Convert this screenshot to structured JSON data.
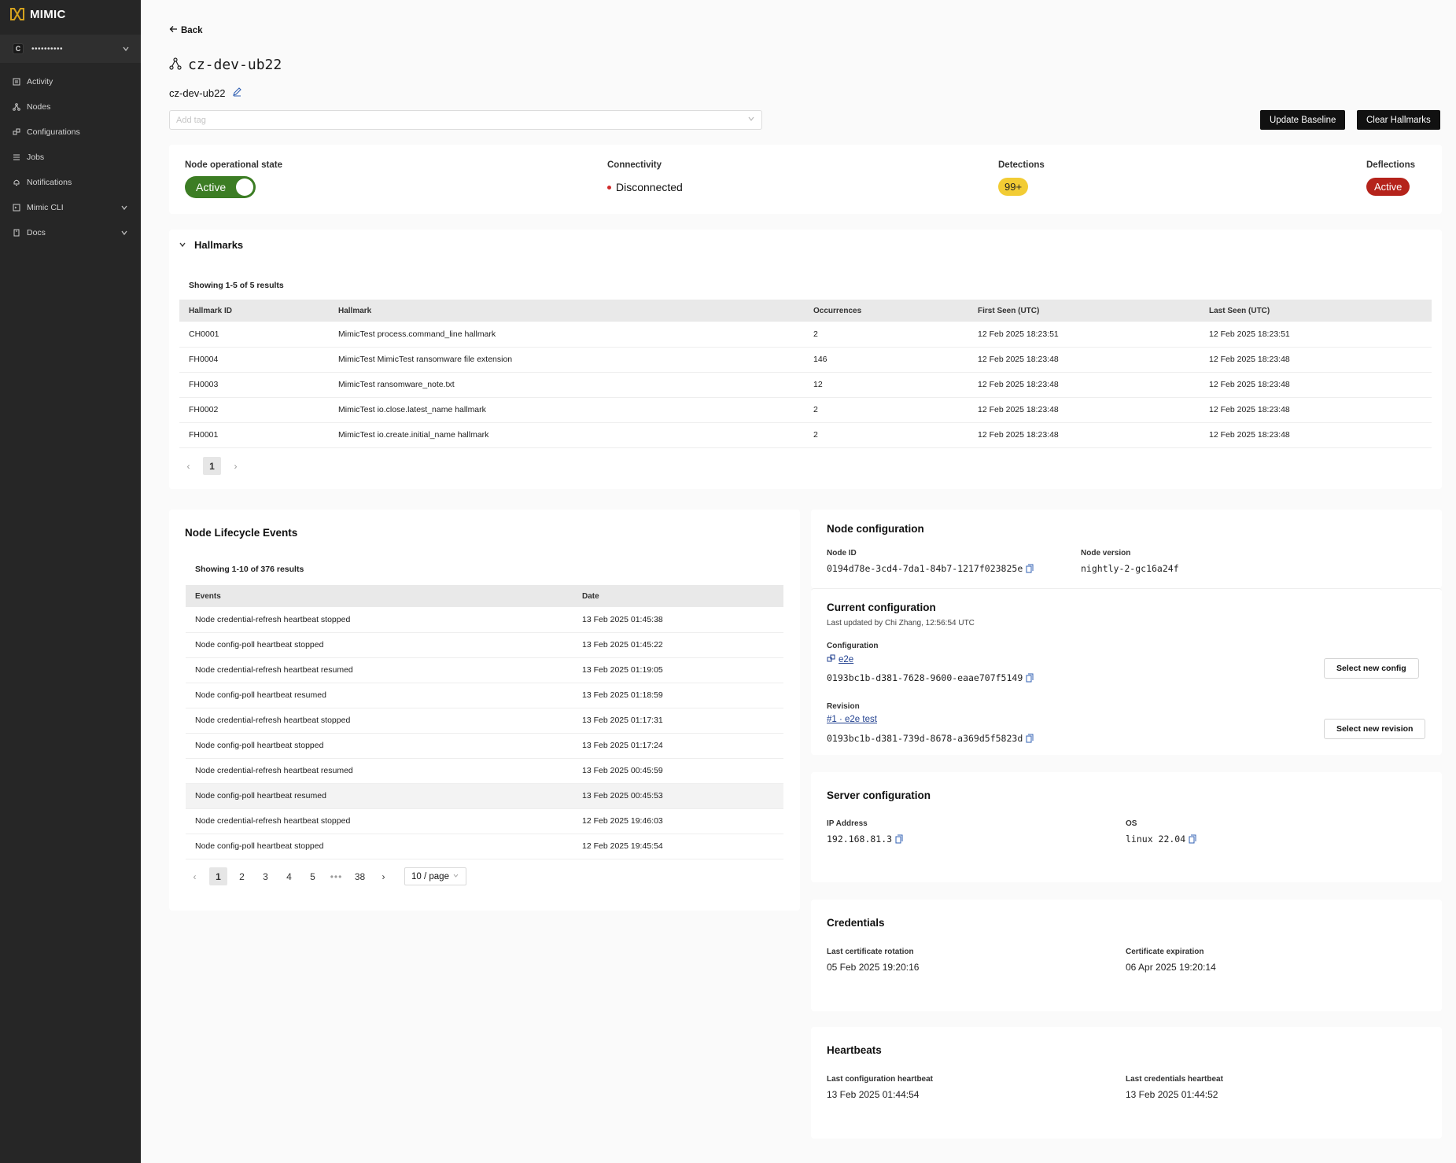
{
  "app": {
    "brand": "MIMIC"
  },
  "sidebar": {
    "org_badge": "C",
    "org_name": "••••••••••",
    "items": [
      {
        "label": "Activity",
        "icon": "activity-icon"
      },
      {
        "label": "Nodes",
        "icon": "nodes-icon"
      },
      {
        "label": "Configurations",
        "icon": "configurations-icon"
      },
      {
        "label": "Jobs",
        "icon": "jobs-icon"
      },
      {
        "label": "Notifications",
        "icon": "bell-icon"
      },
      {
        "label": "Mimic CLI",
        "icon": "terminal-icon",
        "expandable": true
      },
      {
        "label": "Docs",
        "icon": "docs-icon",
        "expandable": true
      }
    ]
  },
  "header": {
    "back_label": "Back",
    "title": "cz-dev-ub22",
    "node_name": "cz-dev-ub22",
    "tag_placeholder": "Add tag",
    "update_baseline_label": "Update Baseline",
    "clear_hallmarks_label": "Clear Hallmarks"
  },
  "status": {
    "operational_label": "Node operational state",
    "operational_value": "Active",
    "connectivity_label": "Connectivity",
    "connectivity_value": "Disconnected",
    "detections_label": "Detections",
    "detections_value": "99+",
    "deflections_label": "Deflections",
    "deflections_value": "Active",
    "colors": {
      "active_green": "#3c7d24",
      "disconnected_red": "#d02b2b",
      "detections_yellow": "#f2cc34",
      "deflections_red": "#b5231b"
    }
  },
  "hallmarks": {
    "title": "Hallmarks",
    "showing": "Showing 1-5 of 5 results",
    "columns": [
      "Hallmark ID",
      "Hallmark",
      "Occurrences",
      "First Seen (UTC)",
      "Last Seen (UTC)"
    ],
    "rows": [
      [
        "CH0001",
        "MimicTest process.command_line hallmark",
        "2",
        "12 Feb 2025 18:23:51",
        "12 Feb 2025 18:23:51"
      ],
      [
        "FH0004",
        "MimicTest MimicTest ransomware file extension",
        "146",
        "12 Feb 2025 18:23:48",
        "12 Feb 2025 18:23:48"
      ],
      [
        "FH0003",
        "MimicTest ransomware_note.txt",
        "12",
        "12 Feb 2025 18:23:48",
        "12 Feb 2025 18:23:48"
      ],
      [
        "FH0002",
        "MimicTest io.close.latest_name hallmark",
        "2",
        "12 Feb 2025 18:23:48",
        "12 Feb 2025 18:23:48"
      ],
      [
        "FH0001",
        "MimicTest io.create.initial_name hallmark",
        "2",
        "12 Feb 2025 18:23:48",
        "12 Feb 2025 18:23:48"
      ]
    ],
    "page": "1"
  },
  "lifecycle": {
    "title": "Node Lifecycle Events",
    "showing": "Showing 1-10 of 376 results",
    "columns": [
      "Events",
      "Date"
    ],
    "rows": [
      [
        "Node credential-refresh heartbeat stopped",
        "13 Feb 2025 01:45:38"
      ],
      [
        "Node config-poll heartbeat stopped",
        "13 Feb 2025 01:45:22"
      ],
      [
        "Node credential-refresh heartbeat resumed",
        "13 Feb 2025 01:19:05"
      ],
      [
        "Node config-poll heartbeat resumed",
        "13 Feb 2025 01:18:59"
      ],
      [
        "Node credential-refresh heartbeat stopped",
        "13 Feb 2025 01:17:31"
      ],
      [
        "Node config-poll heartbeat stopped",
        "13 Feb 2025 01:17:24"
      ],
      [
        "Node credential-refresh heartbeat resumed",
        "13 Feb 2025 00:45:59"
      ],
      [
        "Node config-poll heartbeat resumed",
        "13 Feb 2025 00:45:53"
      ],
      [
        "Node credential-refresh heartbeat stopped",
        "12 Feb 2025 19:46:03"
      ],
      [
        "Node config-poll heartbeat stopped",
        "12 Feb 2025 19:45:54"
      ]
    ],
    "pages": [
      "1",
      "2",
      "3",
      "4",
      "5",
      "•••",
      "38"
    ],
    "page_size": "10 / page"
  },
  "node_config": {
    "title": "Node configuration",
    "node_id_label": "Node ID",
    "node_id": "0194d78e-3cd4-7da1-84b7-1217f023825e",
    "node_version_label": "Node version",
    "node_version": "nightly-2-gc16a24f"
  },
  "current_config": {
    "title": "Current configuration",
    "updated": "Last updated by Chi Zhang, 12:56:54 UTC",
    "config_label": "Configuration",
    "config_name": "e2e",
    "config_id": "0193bc1b-d381-7628-9600-eaae707f5149",
    "select_config_label": "Select new config",
    "revision_label": "Revision",
    "revision_name": "#1 · e2e test",
    "revision_id": "0193bc1b-d381-739d-8678-a369d5f5823d",
    "select_revision_label": "Select new revision"
  },
  "server_config": {
    "title": "Server configuration",
    "ip_label": "IP Address",
    "ip": "192.168.81.3",
    "os_label": "OS",
    "os": "linux 22.04"
  },
  "credentials": {
    "title": "Credentials",
    "rotation_label": "Last certificate rotation",
    "rotation": "05 Feb 2025 19:20:16",
    "expiration_label": "Certificate expiration",
    "expiration": "06 Apr 2025 19:20:14"
  },
  "heartbeats": {
    "title": "Heartbeats",
    "config_label": "Last configuration heartbeat",
    "config_value": "13 Feb 2025 01:44:54",
    "cred_label": "Last credentials heartbeat",
    "cred_value": "13 Feb 2025 01:44:52"
  }
}
